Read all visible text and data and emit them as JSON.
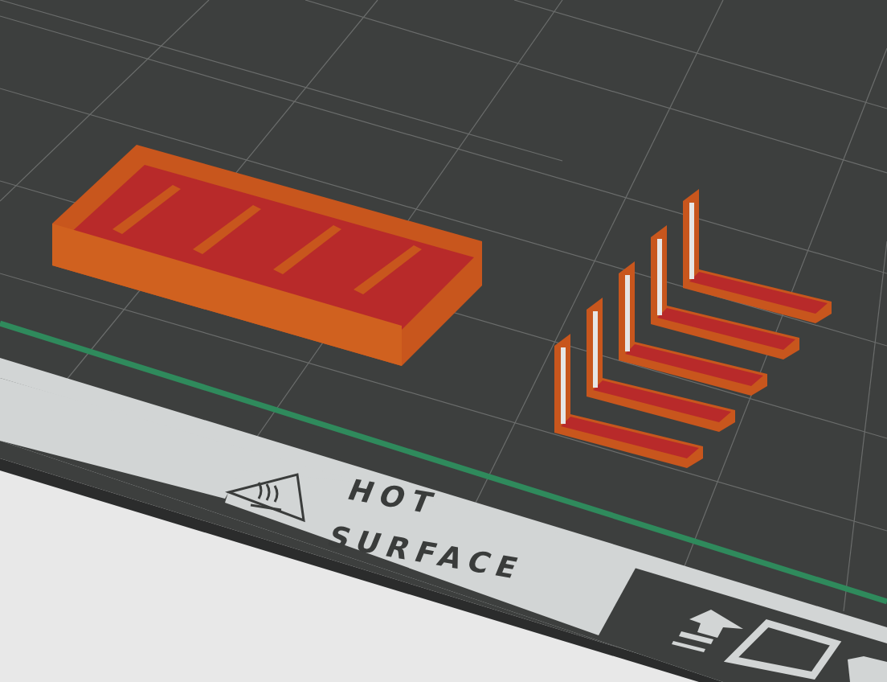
{
  "bed_label": {
    "line_1": "HOT",
    "line_2": "SURFACE"
  }
}
